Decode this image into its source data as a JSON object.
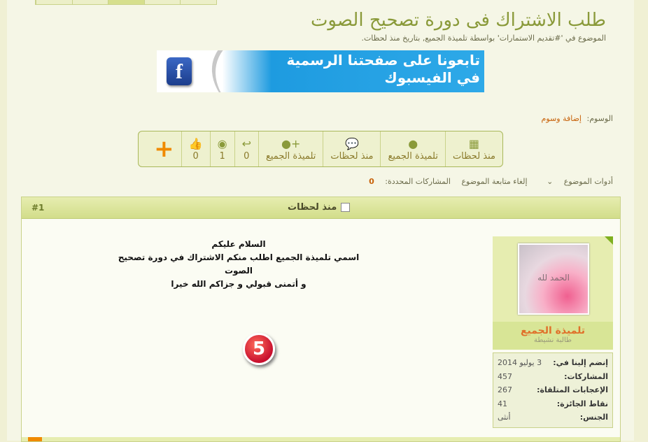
{
  "topic": {
    "title": "طلب الاشتراك فى دورة تصحيح الصوت",
    "subtitle": "الموضوع في '#تقديم الاستمارات' بواسطة تلميذة الجميع, بتاريخ منذ لحظات."
  },
  "banner": {
    "line1": "تابعونا على صفحتنا الرسمية",
    "line2": "في الفيسبوك",
    "icon": "facebook-logo"
  },
  "tags": {
    "label": "الوسوم:",
    "link": "إضافة وسوم"
  },
  "stats": {
    "date": "منذ لحظات",
    "author": "تلميذة الجميع",
    "last_reply": "منذ لحظات",
    "last_poster": "تلميذة الجميع",
    "replies": "0",
    "views": "1",
    "likes": "0",
    "add": "+"
  },
  "tools": {
    "tools_label": "أدوات الموضوع",
    "unwatch": "إلغاء متابعة الموضوع",
    "selected_label": "المشاركات المحددة:",
    "selected_count": "0"
  },
  "post": {
    "number": "#1",
    "time": "منذ لحظات",
    "lines": [
      "السلام عليكم",
      "اسمي تلميذة الجميع اطلب منكم الاشتراك في دورة تصحيح الصوت",
      "و أتمنى قبولي و جزاكم الله خيرا"
    ],
    "badge": "5"
  },
  "user": {
    "name": "تلميذة الجميع",
    "rank": "طالبة نشيطة",
    "avatar_text": "الحمد لله",
    "info": [
      {
        "k": "إنضم إلينا في:",
        "v": "3 يوليو 2014"
      },
      {
        "k": "المشاركات:",
        "v": "457"
      },
      {
        "k": "الإعجابات المتلقاة:",
        "v": "267"
      },
      {
        "k": "نقاط الجائزة:",
        "v": "41"
      },
      {
        "k": "الجنس:",
        "v": "أنثى"
      }
    ]
  }
}
